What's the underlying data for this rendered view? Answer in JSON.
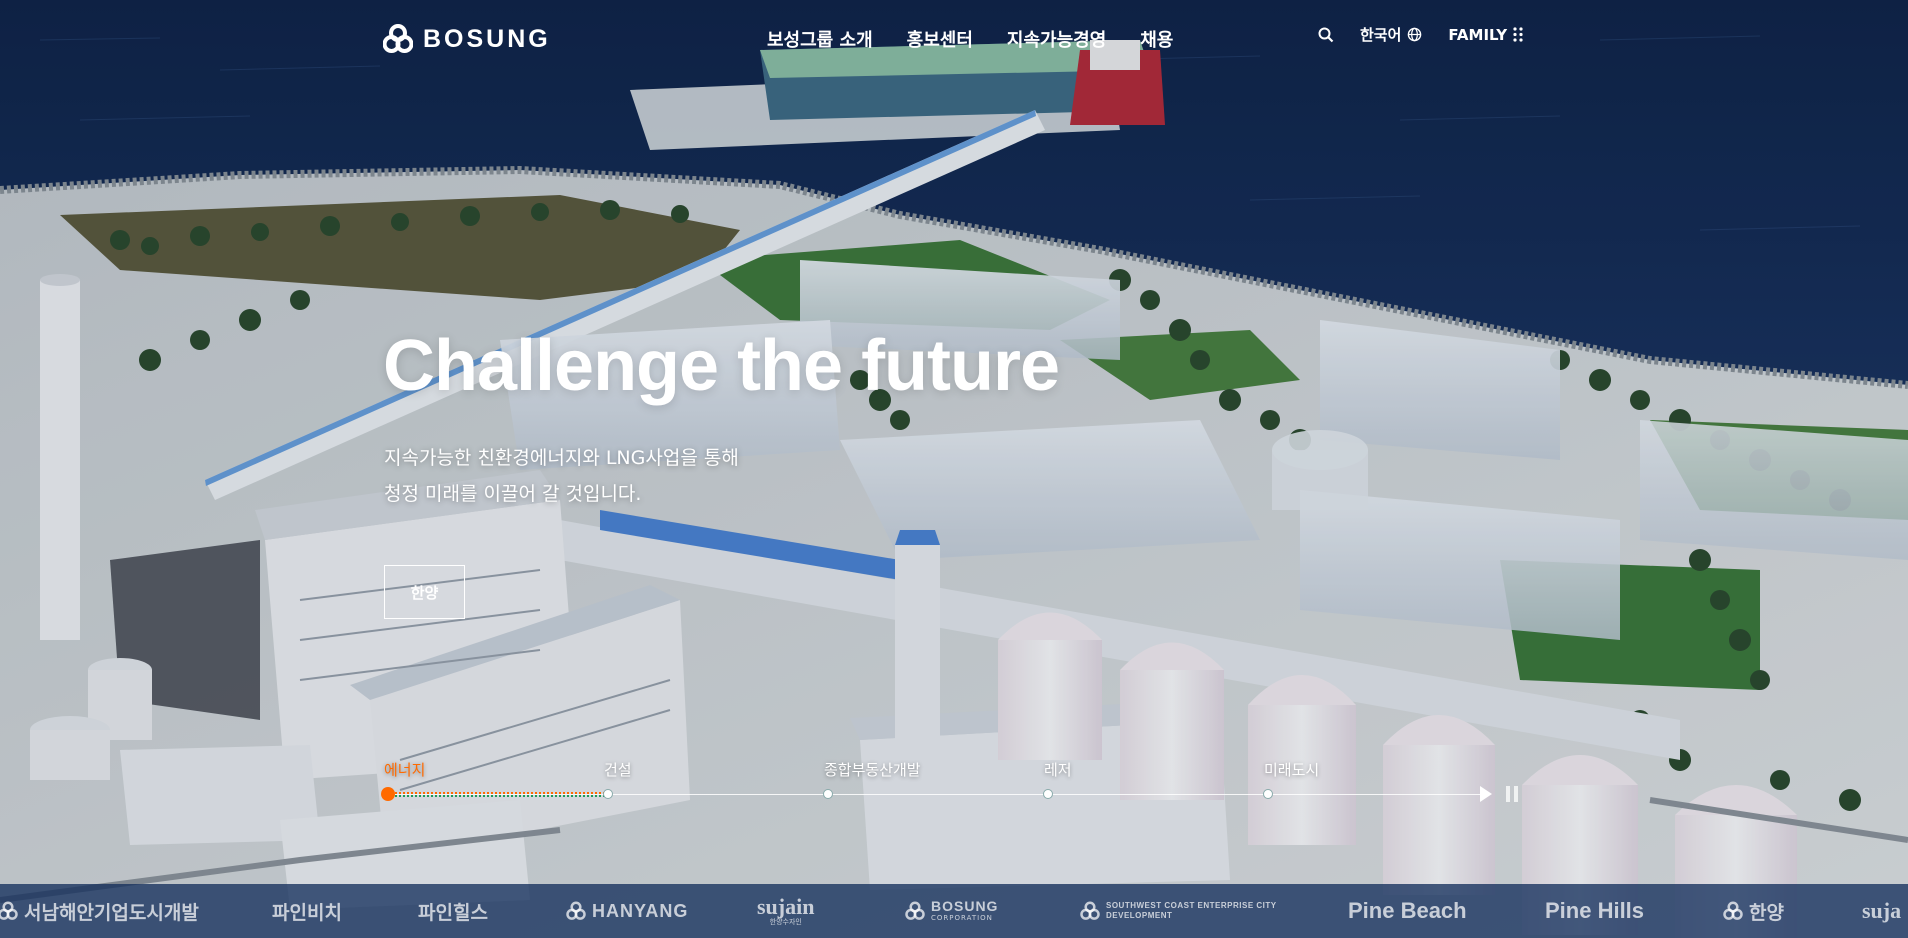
{
  "header": {
    "logo_text": "BOSUNG",
    "nav": [
      "보성그룹 소개",
      "홍보센터",
      "지속가능경영",
      "채용"
    ],
    "language_label": "한국어",
    "family_label": "FAMILY"
  },
  "hero": {
    "title": "Challenge the future",
    "description_line1": "지속가능한 친환경에너지와 LNG사업을 통해",
    "description_line2": "청정 미래를 이끌어 갈 것입니다.",
    "button_label": "한양"
  },
  "slider": {
    "steps": [
      "에너지",
      "건설",
      "종합부동산개발",
      "레저",
      "미래도시"
    ],
    "active_index": 0
  },
  "family_sites": [
    "서남해안기업도시개발",
    "파인비치",
    "파인힐스",
    "HANYANG",
    "sujain",
    "BOSUNG",
    "SOUTHWEST COAST ENTERPRISE CITY DEVELOPMENT",
    "Pine Beach",
    "Pine Hills",
    "한양",
    "suja"
  ],
  "family_sublabels": {
    "sujain": "한양수자인",
    "bosung": "CORPORATION"
  },
  "colors": {
    "accent_orange": "#ff6a00",
    "accent_green": "#1e9b58",
    "sea_blue": "#1b2f52",
    "strip_blue": "#14305c"
  },
  "icons": [
    "search-icon",
    "globe-icon",
    "grid-dots-icon",
    "play-icon",
    "pause-icon",
    "bosung-logo-icon"
  ]
}
